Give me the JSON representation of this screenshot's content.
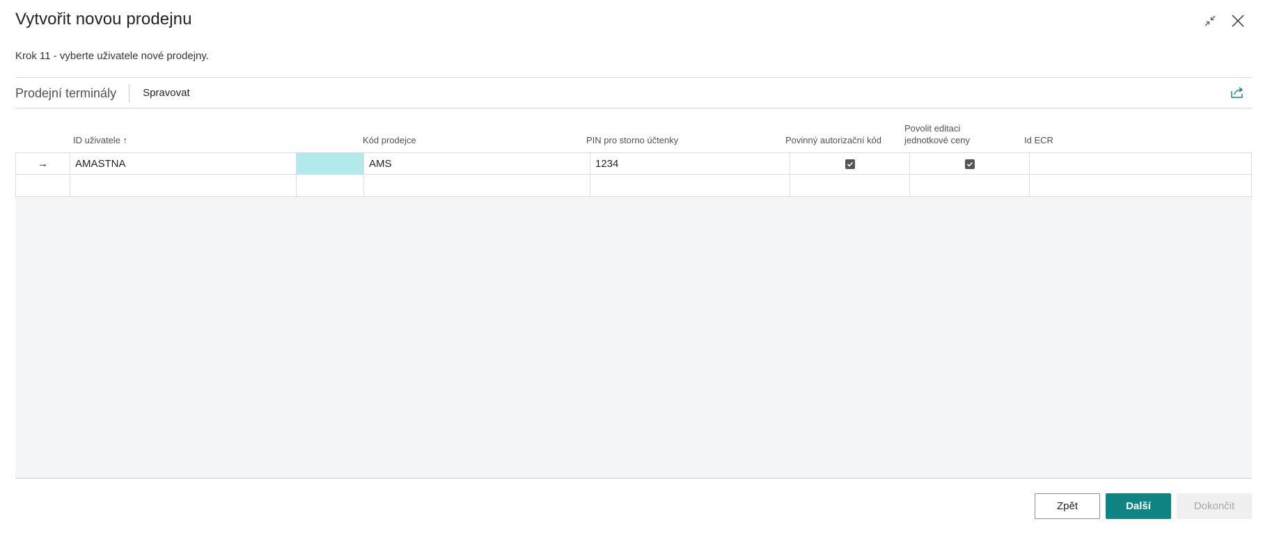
{
  "dialog": {
    "title": "Vytvořit novou prodejnu",
    "step_text": "Krok 11 - vyberte uživatele nové prodejny."
  },
  "window_controls": {
    "collapse_icon": "collapse-icon",
    "close_icon": "close-icon"
  },
  "part": {
    "title": "Prodejní terminály",
    "action_manage": "Spravovat",
    "share_icon": "share-icon"
  },
  "grid": {
    "columns": {
      "user_id": "ID uživatele",
      "salesperson_code": "Kód prodejce",
      "void_pin": "PIN pro storno účtenky",
      "auth_code_required": "Povinný autorizační kód",
      "allow_unit_price_edit_line1": "Povolit editaci",
      "allow_unit_price_edit_line2": "jednotkové ceny",
      "ecr_id": "Id ECR"
    },
    "sort_indicator": "↑",
    "rows": [
      {
        "marker": "→",
        "user_id": "AMASTNA",
        "salesperson_code": "AMS",
        "void_pin": "1234",
        "auth_code_required": true,
        "allow_unit_price_edit": true,
        "ecr_id": ""
      },
      {
        "marker": "",
        "user_id": "",
        "salesperson_code": "",
        "void_pin": "",
        "auth_code_required": false,
        "allow_unit_price_edit": false,
        "ecr_id": ""
      }
    ]
  },
  "footer": {
    "back": "Zpět",
    "next": "Další",
    "finish": "Dokončit"
  },
  "colors": {
    "accent": "#0e8583",
    "selected_cell": "#b2e9ec",
    "grid_background": "#f4f5f7"
  }
}
